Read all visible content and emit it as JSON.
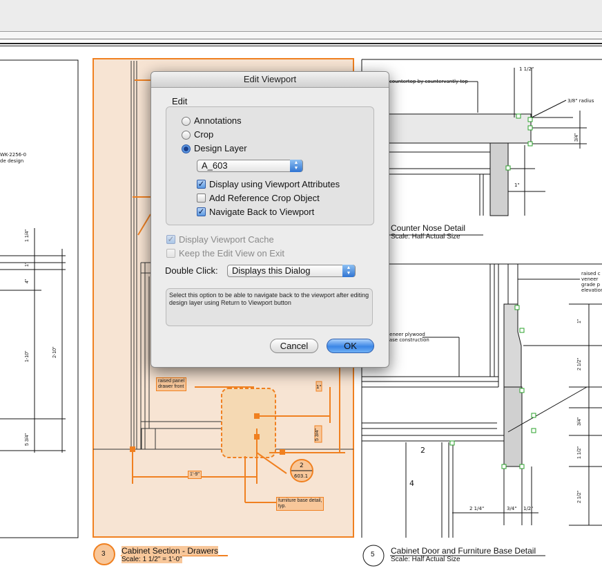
{
  "dialog": {
    "title": "Edit Viewport",
    "group_label": "Edit",
    "radios": [
      {
        "label": "Annotations",
        "selected": false
      },
      {
        "label": "Crop",
        "selected": false
      },
      {
        "label": "Design Layer",
        "selected": true
      }
    ],
    "layer_select": {
      "value": "A_603"
    },
    "checkboxes": [
      {
        "label": "Display using Viewport Attributes",
        "checked": true
      },
      {
        "label": "Add Reference Crop Object",
        "checked": false
      },
      {
        "label": "Navigate Back to Viewport",
        "checked": true
      }
    ],
    "disabled_checkboxes": [
      {
        "label": "Display Viewport Cache",
        "checked": true
      },
      {
        "label": "Keep the Edit View on Exit",
        "checked": false
      }
    ],
    "double_click": {
      "label": "Double Click:",
      "value": "Displays this Dialog"
    },
    "help_text": "Select this option to be able to navigate back to the viewport after editing design layer using Return to Viewport button",
    "cancel_label": "Cancel",
    "ok_label": "OK"
  },
  "drawing": {
    "left_notes": [
      "WK-2256-0",
      "de design"
    ],
    "left_dims": [
      "1 1/4\"",
      "1\"",
      "4\"",
      "1-10\"",
      "2-10\"",
      "5 3/4\""
    ],
    "center": {
      "note_raised_panel": "raised panel\ndrawer front",
      "note_furniture_base": "furniture base detail,\ntyp.",
      "dim_1_9": "1'-9\"",
      "callout_number": "2",
      "callout_sheet": "603.1",
      "dim_small_1": "1\"",
      "dim_small_2": "5 3/4\""
    },
    "viewport_3": {
      "number": "3",
      "title": "Cabinet Section - Drawers",
      "scale": "Scale: 1 1/2\" = 1'-0\""
    },
    "counter_detail": {
      "note_countertop": "countertop by countervantly top",
      "note_radius": "3/8\" radius",
      "dims": [
        "1 1/2\"",
        "3/4\"",
        "1\""
      ],
      "title": "Counter Nose Detail",
      "scale": "Scale: Half Actual Size"
    },
    "door_detail": {
      "note_raised": "raised c\nveneer\ngrade p\nelevation",
      "note_plywood": "veneer plywood\ncase construction",
      "dims_right": [
        "1\"",
        "2 1/2\"",
        "3/4\"",
        "1 1/2\"",
        "2 1/2\""
      ],
      "dims_bottom": [
        "2 1/4\"",
        "3/4\"",
        "1/2\""
      ],
      "labels": [
        "2",
        "4"
      ],
      "number": "5",
      "title": "Cabinet Door and Furniture Base Detail",
      "scale": "Scale: Half Actual Size"
    }
  },
  "colors": {
    "highlight": "#f08020",
    "highlight_fill": "#f7e4d3",
    "snap": "#2aa02a"
  }
}
